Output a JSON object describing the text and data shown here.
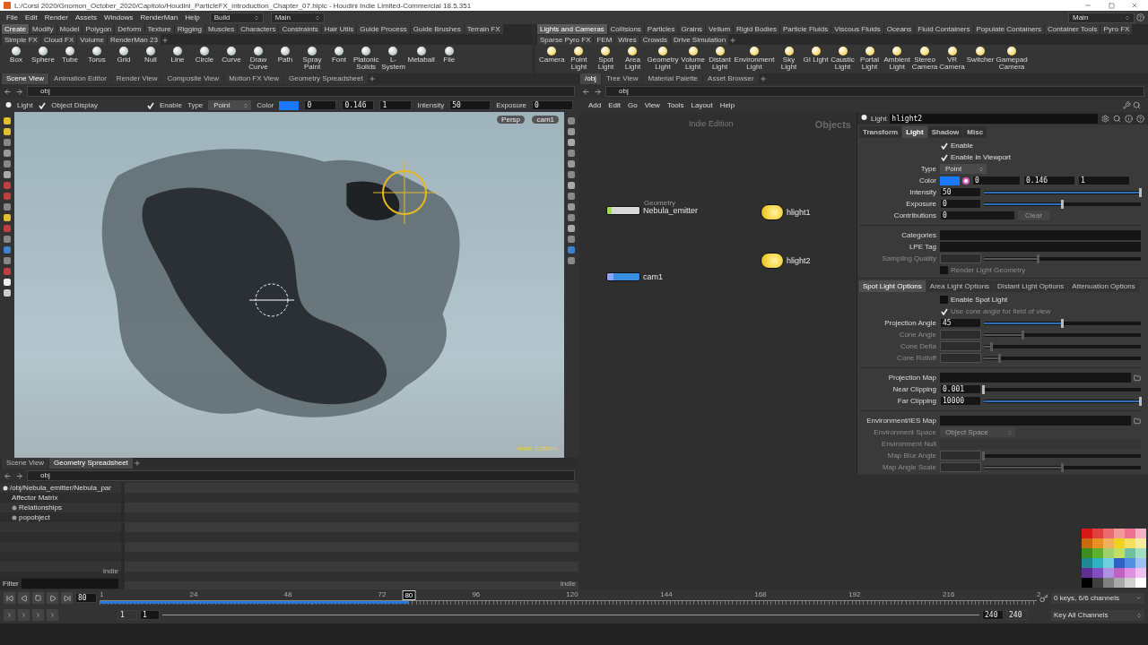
{
  "window": {
    "title": "L:/Corsi 2020/Gnomon_October_2020/Capitolo/Houdini_ParticleFX_introduction_Chapter_07.hiplc - Houdini Indie Limited-Commercial 18.5.351"
  },
  "menu": [
    "File",
    "Edit",
    "Render",
    "Assets",
    "Windows",
    "RenderMan",
    "Help"
  ],
  "desktops": [
    "Build",
    "Main"
  ],
  "desktop_right": "Main",
  "shelves": [
    {
      "tabs": [
        {
          "label": "Create",
          "selected": true
        },
        {
          "label": "Modify",
          "selected": false
        },
        {
          "label": "Model",
          "selected": false
        },
        {
          "label": "Polygon",
          "selected": false
        },
        {
          "label": "Deform",
          "selected": false
        },
        {
          "label": "Texture",
          "selected": false
        },
        {
          "label": "Rigging",
          "selected": false
        },
        {
          "label": "Muscles",
          "selected": false
        },
        {
          "label": "Characters",
          "selected": false
        },
        {
          "label": "Constraints",
          "selected": false
        },
        {
          "label": "Hair Utils",
          "selected": false
        },
        {
          "label": "Guide Process",
          "selected": false
        },
        {
          "label": "Guide Brushes",
          "selected": false
        },
        {
          "label": "Terrain FX",
          "selected": false
        },
        {
          "label": "Simple FX",
          "selected": false
        },
        {
          "label": "Cloud FX",
          "selected": false
        },
        {
          "label": "Volume",
          "selected": false
        },
        {
          "label": "RenderMan 23",
          "selected": false
        }
      ],
      "tools": [
        "Box",
        "Sphere",
        "Tube",
        "Torus",
        "Grid",
        "Null",
        "Line",
        "Circle",
        "Curve",
        "Draw Curve",
        "Path",
        "Spray Paint",
        "Font",
        "Platonic Solids",
        "L-System",
        "Metaball",
        "File"
      ]
    },
    {
      "tabs": [
        {
          "label": "Lights and Cameras",
          "selected": true
        },
        {
          "label": "Collisions",
          "selected": false
        },
        {
          "label": "Particles",
          "selected": false
        },
        {
          "label": "Grains",
          "selected": false
        },
        {
          "label": "Vellum",
          "selected": false
        },
        {
          "label": "Rigid Bodies",
          "selected": false
        },
        {
          "label": "Particle Fluids",
          "selected": false
        },
        {
          "label": "Viscous Fluids",
          "selected": false
        },
        {
          "label": "Oceans",
          "selected": false
        },
        {
          "label": "Fluid Containers",
          "selected": false
        },
        {
          "label": "Populate Containers",
          "selected": false
        },
        {
          "label": "Container Tools",
          "selected": false
        },
        {
          "label": "Pyro FX",
          "selected": false
        },
        {
          "label": "Sparse Pyro FX",
          "selected": false
        },
        {
          "label": "FEM",
          "selected": false
        },
        {
          "label": "Wires",
          "selected": false
        },
        {
          "label": "Crowds",
          "selected": false
        },
        {
          "label": "Drive Simulation",
          "selected": false
        }
      ],
      "tools": [
        "Camera",
        "Point Light",
        "Spot Light",
        "Area Light",
        "Geometry Light",
        "Volume Light",
        "Distant Light",
        "Environment Light",
        "Sky Light",
        "GI Light",
        "Caustic Light",
        "Portal Light",
        "Ambient Light",
        "Stereo Camera",
        "VR Camera",
        "Switcher",
        "Gamepad Camera"
      ]
    }
  ],
  "scene_pane": {
    "tabs": [
      {
        "label": "Scene View",
        "selected": true
      },
      {
        "label": "Animation Editor",
        "selected": false
      },
      {
        "label": "Render View",
        "selected": false
      },
      {
        "label": "Composite View",
        "selected": false
      },
      {
        "label": "Motion FX View",
        "selected": false
      },
      {
        "label": "Geometry Spreadsheet",
        "selected": false
      }
    ],
    "path": "obj",
    "operation_bar": {
      "tool": "Light",
      "object_display": {
        "label": "Object Display",
        "checked": true
      },
      "enable": {
        "label": "Enable",
        "checked": true
      },
      "type_label": "Type",
      "type_value": "Point",
      "color_label": "Color",
      "color_values": [
        "0",
        "0.146",
        "1"
      ],
      "intensity_label": "Intensity",
      "intensity": "50",
      "exposure_label": "Exposure",
      "exposure": "0"
    },
    "viewport": {
      "camera_menus": [
        "Persp",
        "cam1"
      ],
      "edition_label": "Indie Edition"
    }
  },
  "spreadsheet_pane": {
    "tabs": [
      {
        "label": "Scene View",
        "selected": false
      },
      {
        "label": "Geometry Spreadsheet",
        "selected": true
      }
    ],
    "path": "obj",
    "tree": [
      {
        "label": "/obj/Nebula_emitter/Nebula_par",
        "expanded": true,
        "children": [
          {
            "label": "Affector Matrix"
          },
          {
            "label": "Relationships",
            "expanded": false
          },
          {
            "label": "popobject",
            "expanded": false
          }
        ]
      }
    ],
    "tree_corner": "Indie",
    "table_corner": "Indie",
    "filter_label": "Filter"
  },
  "network_pane": {
    "tabs": [
      {
        "label": "/obj",
        "selected": true
      },
      {
        "label": "Tree View",
        "selected": false
      },
      {
        "label": "Material Palette",
        "selected": false
      },
      {
        "label": "Asset Browser",
        "selected": false
      }
    ],
    "path": "obj",
    "menu": [
      "Add",
      "Edit",
      "Go",
      "View",
      "Tools",
      "Layout",
      "Help"
    ],
    "edition_label": "Indie Edition",
    "context_label": "Objects",
    "nodes": [
      {
        "name": "Nebula_emitter",
        "type_label": "Geometry",
        "kind": "geometry"
      },
      {
        "name": "hlight1",
        "kind": "light"
      },
      {
        "name": "hlight2",
        "kind": "light"
      },
      {
        "name": "cam1",
        "kind": "camera"
      }
    ]
  },
  "parameters": {
    "type_label": "Light",
    "node_name": "hlight2",
    "tabs": [
      {
        "label": "Transform",
        "selected": false
      },
      {
        "label": "Light",
        "selected": true
      },
      {
        "label": "Shadow",
        "selected": false
      },
      {
        "label": "Misc",
        "selected": false
      }
    ],
    "params": [
      {
        "kind": "toggle",
        "label": "Enable",
        "checked": true,
        "disabled": false
      },
      {
        "kind": "toggle",
        "label": "Enable In Viewport",
        "checked": true,
        "disabled": false
      },
      {
        "kind": "menu",
        "label": "Type",
        "value": "Point",
        "disabled": false
      },
      {
        "kind": "color",
        "label": "Color",
        "values": [
          "0",
          "0.146",
          "1"
        ],
        "disabled": false
      },
      {
        "kind": "slider",
        "label": "Intensity",
        "value": "50",
        "level": 1,
        "disabled": false
      },
      {
        "kind": "slider",
        "label": "Exposure",
        "value": "0",
        "level": 0.5,
        "disabled": false
      },
      {
        "kind": "field",
        "label": "Contributions",
        "value": "0",
        "button": "Clear",
        "disabled": false
      },
      {
        "kind": "separator"
      },
      {
        "kind": "field",
        "label": "Categories",
        "disabled": false
      },
      {
        "kind": "field",
        "label": "LPE Tag",
        "disabled": false
      },
      {
        "kind": "slider",
        "label": "Sampling Quality",
        "level": 0.35,
        "disabled": true
      },
      {
        "kind": "toggle",
        "label": "Render Light Geometry",
        "checked": false,
        "disabled": true
      }
    ],
    "subtabs": [
      {
        "label": "Spot Light Options",
        "selected": true
      },
      {
        "label": "Area Light Options",
        "selected": false
      },
      {
        "label": "Distant Light Options",
        "selected": false
      },
      {
        "label": "Attenuation Options",
        "selected": false
      }
    ],
    "subparams": [
      {
        "kind": "toggle",
        "label": "Enable Spot Light",
        "checked": false,
        "disabled": false
      },
      {
        "kind": "toggle",
        "label": "Use cone angle for field of view",
        "checked": true,
        "disabled": true
      },
      {
        "kind": "slider",
        "label": "Projection Angle",
        "value": "45",
        "level": 0.5,
        "disabled": false
      },
      {
        "kind": "slider",
        "label": "Cone Angle",
        "level": 0.25,
        "disabled": true
      },
      {
        "kind": "slider",
        "label": "Cone Delta",
        "level": 0.05,
        "disabled": true
      },
      {
        "kind": "slider",
        "label": "Cone Rolloff",
        "level": 0.1,
        "disabled": true
      },
      {
        "kind": "separator"
      },
      {
        "kind": "file",
        "label": "Projection Map",
        "disabled": false
      },
      {
        "kind": "slider",
        "label": "Near Clipping",
        "value": "0.001",
        "level": 0,
        "disabled": false
      },
      {
        "kind": "slider",
        "label": "Far Clipping",
        "value": "10000",
        "level": 1,
        "disabled": false
      },
      {
        "kind": "separator"
      },
      {
        "kind": "file",
        "label": "Environment/IES Map",
        "disabled": false
      },
      {
        "kind": "menu",
        "label": "Environment Space",
        "value": "Object Space",
        "disabled": true
      },
      {
        "kind": "field",
        "label": "Environment Null",
        "disabled": true
      },
      {
        "kind": "slider",
        "label": "Map Blur Angle",
        "level": 0,
        "disabled": true
      },
      {
        "kind": "slider",
        "label": "Map Angle Scale",
        "level": 0.5,
        "disabled": true
      }
    ]
  },
  "palette": [
    {
      "color": "#d81818"
    },
    {
      "color": "#e04040"
    },
    {
      "color": "#e86a6a"
    },
    {
      "color": "#f29a9a"
    },
    {
      "color": "#f07090"
    },
    {
      "color": "#f4b0c4"
    },
    {
      "color": "#c86a10"
    },
    {
      "color": "#e89020"
    },
    {
      "color": "#f0b060"
    },
    {
      "color": "#f0d020"
    },
    {
      "color": "#f4e060"
    },
    {
      "color": "#f6eca0"
    },
    {
      "color": "#3c8c20"
    },
    {
      "color": "#60b030"
    },
    {
      "color": "#a0d070"
    },
    {
      "color": "#c0e060"
    },
    {
      "color": "#70c0a0"
    },
    {
      "color": "#a0e0c0"
    },
    {
      "color": "#208890"
    },
    {
      "color": "#30b0c0"
    },
    {
      "color": "#70d0e0"
    },
    {
      "color": "#3060c0"
    },
    {
      "color": "#5090e0"
    },
    {
      "color": "#a0c0f0"
    },
    {
      "color": "#603090"
    },
    {
      "color": "#8050c0"
    },
    {
      "color": "#b090e0"
    },
    {
      "color": "#c060c0"
    },
    {
      "color": "#e090e0"
    },
    {
      "color": "#f0c0f0"
    },
    {
      "color": "#000000"
    },
    {
      "color": "#404040"
    },
    {
      "color": "#808080"
    },
    {
      "color": "#a8a8a8"
    },
    {
      "color": "#d0d0d0"
    },
    {
      "color": "#ffffff"
    }
  ],
  "timeline": {
    "frame": "80",
    "frame_marker": "80",
    "level": 0.33,
    "ticks": [
      "1",
      "24",
      "48",
      "72",
      "96",
      "120",
      "144",
      "168",
      "192",
      "216",
      "2"
    ],
    "start": "1",
    "start_visible": "1",
    "end_visible": "240",
    "end": "240",
    "keys_menu": "0 keys, 6/6 channels",
    "key_mode": "Key All Channels"
  }
}
